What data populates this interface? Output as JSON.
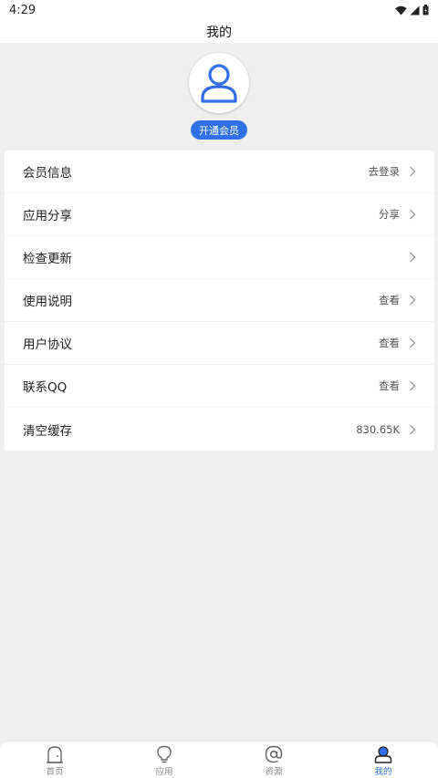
{
  "status_bar": {
    "time": "4:29",
    "icons": [
      "wifi-icon",
      "signal-icon",
      "battery-icon"
    ]
  },
  "header": {
    "title": "我的"
  },
  "profile": {
    "avatar_icon": "user-icon",
    "vip_button_label": "开通会员",
    "accent_color": "#2f6fe8"
  },
  "menu": {
    "items": [
      {
        "label": "会员信息",
        "value": "去登录"
      },
      {
        "label": "应用分享",
        "value": "分享"
      },
      {
        "label": "检查更新",
        "value": ""
      },
      {
        "label": "使用说明",
        "value": "查看"
      },
      {
        "label": "用户协议",
        "value": "查看"
      },
      {
        "label": "联系QQ",
        "value": "查看"
      },
      {
        "label": "清空缓存",
        "value": "830.65K"
      }
    ]
  },
  "tabbar": {
    "active_tab": "我的",
    "tabs": [
      {
        "label": "首页",
        "icon": "home-icon"
      },
      {
        "label": "应用",
        "icon": "lightbulb-icon"
      },
      {
        "label": "资源",
        "icon": "at-sign-icon"
      },
      {
        "label": "我的",
        "icon": "profile-icon"
      }
    ]
  }
}
